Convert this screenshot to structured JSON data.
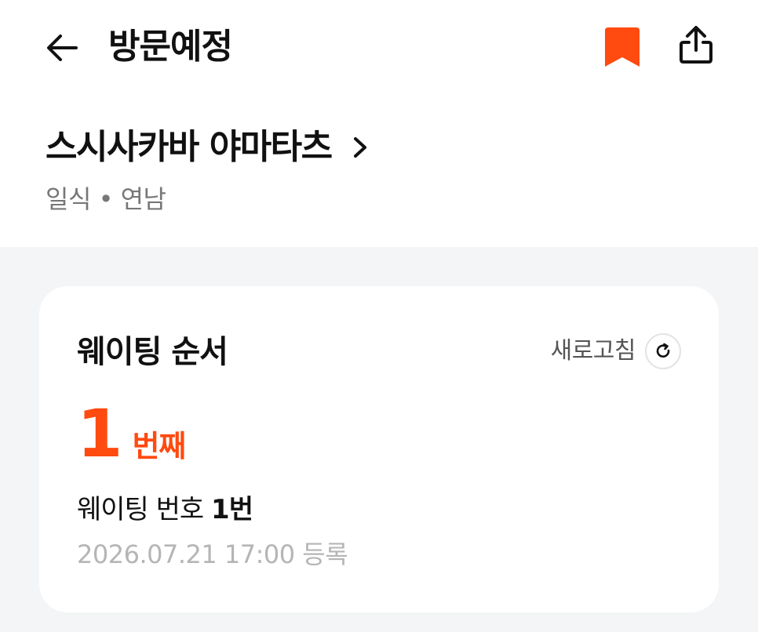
{
  "header": {
    "title": "방문예정",
    "back_icon": "arrow-left-icon",
    "bookmark_icon": "bookmark-icon",
    "share_icon": "share-icon",
    "accent_color": "#ff4a10"
  },
  "restaurant": {
    "name": "스시사카바 야마타츠",
    "category": "일식",
    "separator": "•",
    "area": "연남"
  },
  "waiting_card": {
    "title": "웨이팅 순서",
    "refresh_label": "새로고침",
    "refresh_icon": "refresh-icon",
    "order_number": "1",
    "order_suffix": "번째",
    "waiting_number_label": "웨이팅 번호",
    "waiting_number_value": "1번",
    "registered_at": "2026.07.21 17:00",
    "registered_suffix": "등록"
  }
}
